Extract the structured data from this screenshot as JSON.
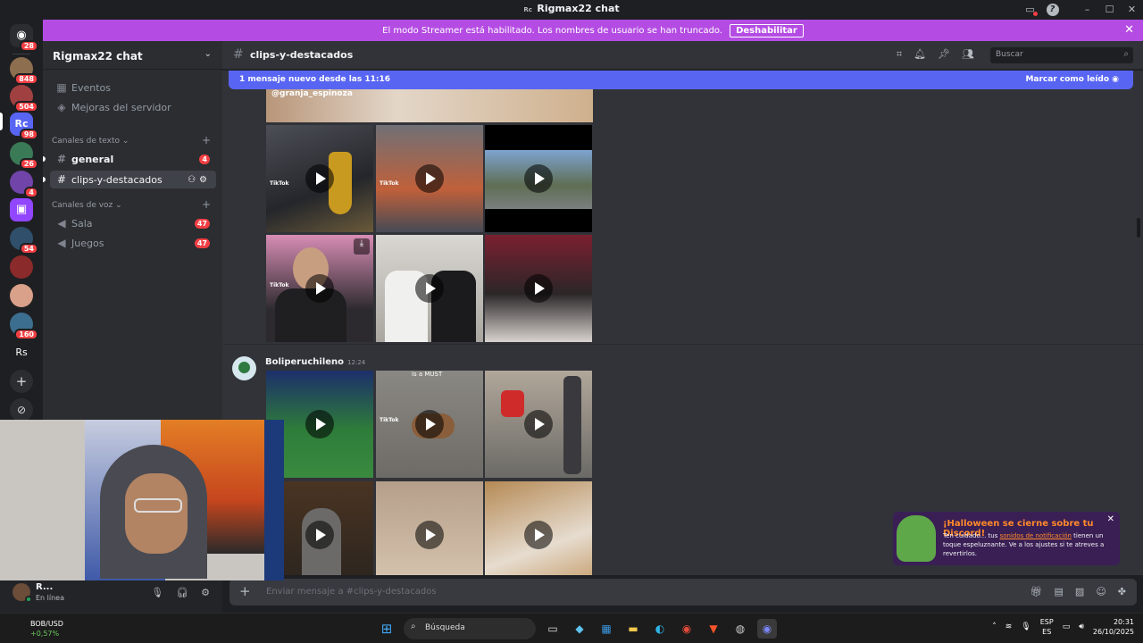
{
  "window": {
    "title": "Rigmax22 chat",
    "app_icon": "Rc"
  },
  "banner": {
    "text": "El modo Streamer está habilitado. Los nombres de usuario se han truncado.",
    "button": "Deshabilitar"
  },
  "servers": [
    {
      "badge": "28"
    },
    {
      "badge": "848"
    },
    {
      "badge": "504"
    },
    {
      "label": "Rc",
      "badge": "98"
    },
    {
      "badge": "26"
    },
    {
      "badge": "4"
    },
    {
      "badge": ""
    },
    {
      "badge": "54"
    },
    {
      "badge": ""
    },
    {
      "badge": ""
    },
    {
      "badge": "160"
    },
    {
      "label": "Rs",
      "badge": ""
    }
  ],
  "guild": {
    "name": "Rigmax22 chat"
  },
  "sidebar": {
    "events": "Eventos",
    "boosts": "Mejoras del servidor",
    "text_category": "Canales de texto",
    "voice_category": "Canales de voz",
    "text_channels": [
      {
        "name": "general",
        "count": "4"
      },
      {
        "name": "clips-y-destacados",
        "count": ""
      }
    ],
    "voice_channels": [
      {
        "name": "Sala",
        "count": "47"
      },
      {
        "name": "Juegos",
        "count": "47"
      }
    ]
  },
  "user": {
    "name": "R...",
    "status": "En línea"
  },
  "header": {
    "channel": "clips-y-destacados",
    "search_placeholder": "Buscar"
  },
  "newbar": {
    "text": "1 mensaje nuevo desde las 11:16",
    "action": "Marcar como leído"
  },
  "messages": [
    {
      "watermark": "@granja_espinoza"
    },
    {
      "author": "Boliperuchileno",
      "time": "12:24"
    }
  ],
  "video_labels": {
    "tiktok": "TikTok",
    "must": "is a MUST"
  },
  "composer": {
    "placeholder": "Enviar mensaje a #clips-y-destacados"
  },
  "toast": {
    "title": "¡Halloween se cierne sobre tu Discord!",
    "body_pre": "Ten cuidado... tus ",
    "body_link": "sonidos de notificación",
    "body_post": " tienen un toque espeluznante. Ve a los ajustes si te atreves a revertirlos."
  },
  "taskbar": {
    "ticker": "BOB/USD",
    "change": "+0,57%",
    "search": "Búsqueda",
    "lang_1": "ESP",
    "lang_2": "ES",
    "time": "20:31",
    "date": "26/10/2025"
  },
  "colors": {
    "accent": "#5865f2",
    "banner": "#b44ce3",
    "badge": "#f23f43",
    "online": "#23a55a"
  }
}
